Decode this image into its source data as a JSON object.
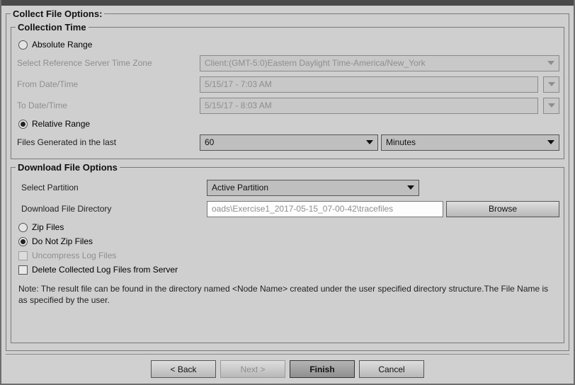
{
  "titlebar": {
    "title": ""
  },
  "collect": {
    "legend": "Collect File Options:",
    "collection_time": {
      "legend": "Collection Time",
      "absolute_range_label": "Absolute Range",
      "ref_tz_label": "Select Reference Server Time Zone",
      "ref_tz_value": "Client:(GMT-5:0)Eastern Daylight Time-America/New_York",
      "from_label": "From Date/Time",
      "from_value": "5/15/17 - 7:03 AM",
      "to_label": "To Date/Time",
      "to_value": "5/15/17 - 8:03 AM",
      "relative_range_label": "Relative Range",
      "files_generated_label": "Files Generated in the last",
      "files_generated_value": "60",
      "files_generated_unit": "Minutes"
    },
    "download": {
      "legend": "Download File Options",
      "select_partition_label": "Select Partition",
      "select_partition_value": "Active Partition",
      "download_dir_label": "Download File Directory",
      "download_dir_value": "oads\\Exercise1_2017-05-15_07-00-42\\tracefiles",
      "browse_label": "Browse",
      "zip_files_label": "Zip Files",
      "do_not_zip_label": "Do Not Zip Files",
      "uncompress_label": "Uncompress Log Files",
      "delete_collected_label": "Delete Collected Log Files from Server",
      "note": "Note: The result file can be found in the directory named <Node Name> created under the user specified directory structure.The File Name is as specified by the user."
    }
  },
  "buttons": {
    "back": "< Back",
    "next": "Next >",
    "finish": "Finish",
    "cancel": "Cancel"
  }
}
